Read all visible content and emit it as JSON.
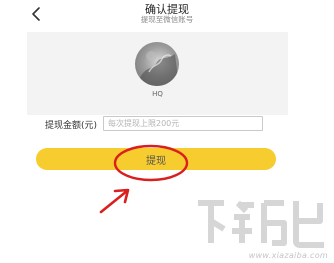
{
  "header": {
    "title": "确认提现",
    "subtitle": "提现至微信账号",
    "back_icon": "chevron-left-icon"
  },
  "account": {
    "name": "HQ",
    "avatar_icon": "avatar-photo"
  },
  "amount": {
    "label": "提现金额(元)",
    "value": "",
    "placeholder": "每次提现上限200元"
  },
  "actions": {
    "submit_label": "提现"
  },
  "annotations": {
    "circle_color": "#d91f1f",
    "arrow_color": "#d91f1f"
  },
  "watermark": {
    "url": "www.xiazaiba.com"
  },
  "colors": {
    "accent": "#f7cc2f",
    "card_bg": "#f3f3f4"
  }
}
